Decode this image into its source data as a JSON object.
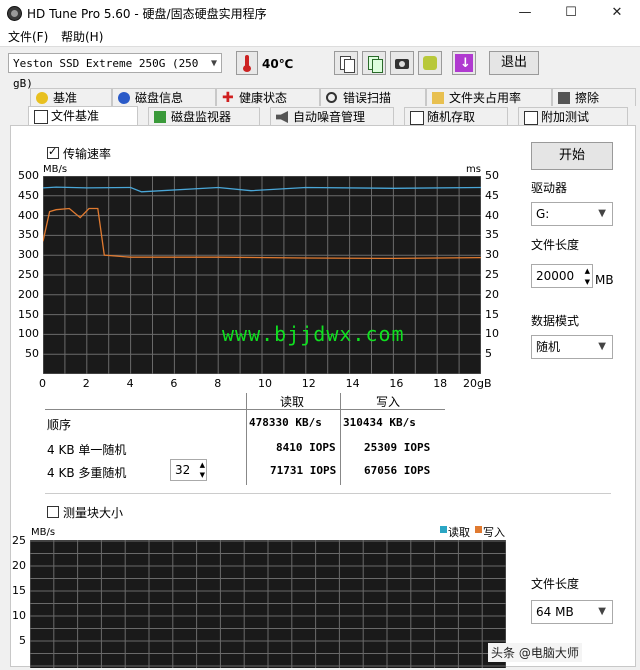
{
  "window": {
    "title": "HD Tune Pro 5.60 - 硬盘/固态硬盘实用程序",
    "minimize": "—",
    "maximize": "☐",
    "close": "✕"
  },
  "menu": {
    "file": "文件(F)",
    "help": "帮助(H)"
  },
  "toolbar": {
    "drive": "Yeston SSD Extreme 250G (250 gB)",
    "temperature": "40℃",
    "exit": "退出"
  },
  "tabs_row1": [
    {
      "label": "基准"
    },
    {
      "label": "磁盘信息"
    },
    {
      "label": "健康状态"
    },
    {
      "label": "错误扫描"
    },
    {
      "label": "文件夹占用率"
    },
    {
      "label": "擦除"
    }
  ],
  "tabs_row2": [
    {
      "label": "文件基准"
    },
    {
      "label": "磁盘监视器"
    },
    {
      "label": "自动噪音管理"
    },
    {
      "label": "随机存取"
    },
    {
      "label": "附加测试"
    }
  ],
  "benchmark": {
    "transfer_rate_label": "传输速率",
    "transfer_rate_checked": true,
    "unit_left": "MB/s",
    "unit_right": "ms",
    "watermark": "www.bjjdwx.com",
    "y_left_ticks": [
      "500",
      "450",
      "400",
      "350",
      "300",
      "250",
      "200",
      "150",
      "100",
      "50"
    ],
    "y_right_ticks": [
      "50",
      "45",
      "40",
      "35",
      "30",
      "25",
      "20",
      "15",
      "10",
      "5"
    ],
    "x_ticks": [
      "0",
      "2",
      "4",
      "6",
      "8",
      "10",
      "12",
      "14",
      "16",
      "18",
      "20gB"
    ]
  },
  "chart_data": {
    "type": "line",
    "xlabel": "",
    "ylabel": "MB/s",
    "x_unit": "gB",
    "xlim": [
      0,
      20
    ],
    "ylim": [
      0,
      500
    ],
    "y2lim": [
      0,
      50
    ],
    "grid": true,
    "series": [
      {
        "color": "#e07a30",
        "x": [
          0,
          0.3,
          0.6,
          1.2,
          1.7,
          2.1,
          2.5,
          2.6,
          2.8,
          4,
          8,
          12,
          16,
          20
        ],
        "values": [
          335,
          410,
          415,
          418,
          395,
          418,
          418,
          380,
          300,
          295,
          295,
          293,
          292,
          294
        ]
      },
      {
        "color": "#4aa7d8",
        "x": [
          0,
          0.6,
          2,
          4,
          4.5,
          8,
          9.5,
          12,
          16,
          20
        ],
        "values": [
          470,
          472,
          470,
          471,
          460,
          471,
          463,
          471,
          469,
          471
        ]
      }
    ]
  },
  "results": {
    "header_read": "读取",
    "header_write": "写入",
    "rows": [
      {
        "label": "顺序",
        "read": "478330 KB/s",
        "write": "310434 KB/s"
      },
      {
        "label": "4 KB 单一随机",
        "read": "8410 IOPS",
        "write": "25309 IOPS"
      },
      {
        "label": "4 KB 多重随机",
        "read": "71731 IOPS",
        "write": "67056 IOPS"
      }
    ],
    "queue_depth": "32"
  },
  "right_panel": {
    "start": "开始",
    "drive_label": "驱动器",
    "drive_value": "G:",
    "file_length_label": "文件长度",
    "file_length_value": "20000",
    "file_length_unit": "MB",
    "data_mode_label": "数据模式",
    "data_mode_value": "随机"
  },
  "block": {
    "label": "测量块大小",
    "checked": false,
    "unit": "MB/s",
    "y_ticks": [
      "25",
      "20",
      "15",
      "10",
      "5"
    ],
    "legend_read": "读取",
    "legend_write": "写入",
    "read_color": "#2ba6c4",
    "write_color": "#e07a30"
  },
  "block_right": {
    "file_length_label": "文件长度",
    "file_length_value": "64 MB"
  },
  "footer": {
    "watermark": "头条 @电脑大师"
  }
}
